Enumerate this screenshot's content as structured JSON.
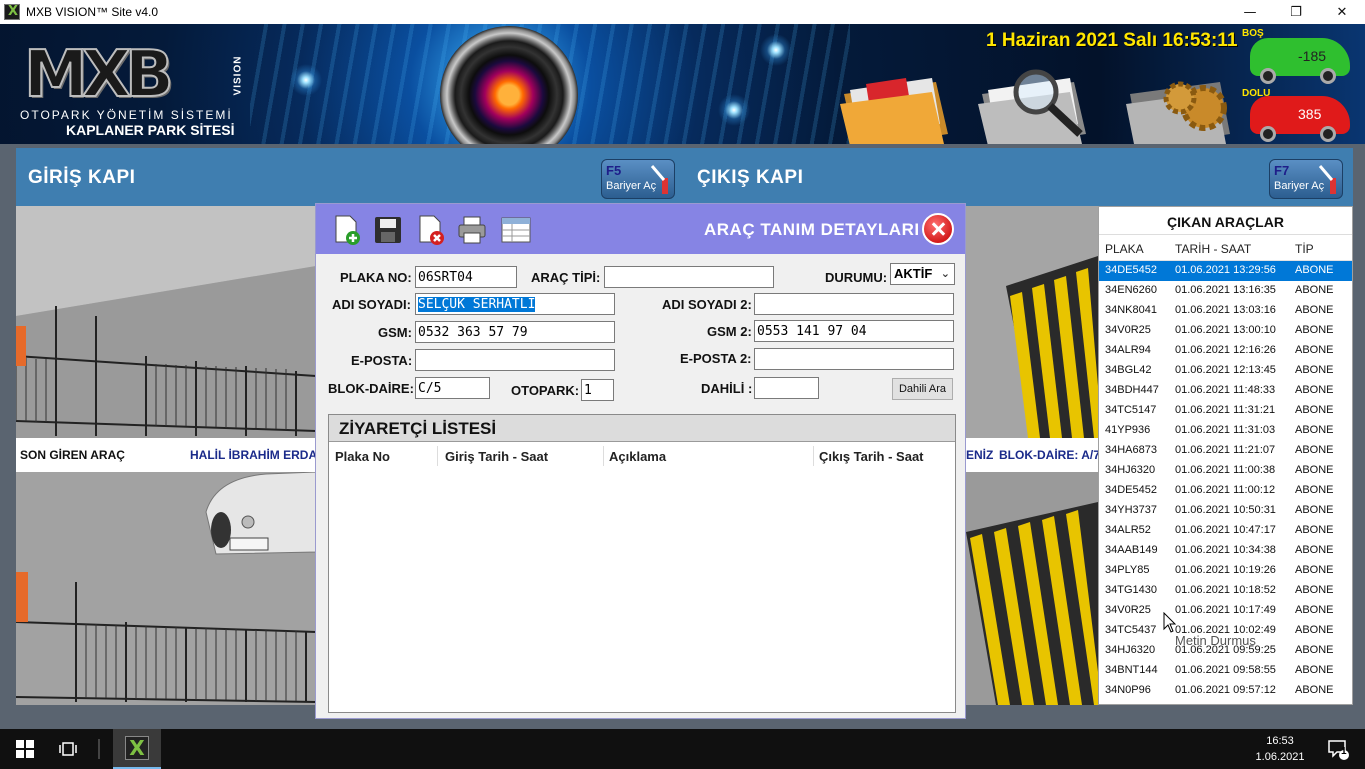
{
  "window": {
    "title": "MXB VISION™ Site v4.0",
    "minimize_icon": "minimize-icon",
    "maximize_icon": "restore-icon",
    "close_icon": "close-icon"
  },
  "banner": {
    "logo_text": "MXB",
    "logo_vision": "VISION",
    "subtitle1": "OTOPARK YÖNETİM SİSTEMİ",
    "subtitle2": "KAPLANER PARK SİTESİ",
    "datetime": "1 Haziran 2021 Salı 16:53:11",
    "empty_label": "BOŞ",
    "empty_count": "-185",
    "full_label": "DOLU",
    "full_count": "385"
  },
  "entry": {
    "title": "GİRİŞ KAPI",
    "barrier_key": "F5",
    "barrier_label": "Bariyer Aç"
  },
  "exit": {
    "title": "ÇIKIŞ KAPI",
    "barrier_key": "F7",
    "barrier_label": "Bariyer Aç"
  },
  "info_strip": {
    "last_entry_label": "SON GİREN ARAÇ",
    "last_entry_name": "HALİL İBRAHİM ERDAL",
    "right_name_fragment": "ENİZ",
    "right_block": "BLOK-DAİRE: A/7"
  },
  "dialog": {
    "title": "ARAÇ TANIM DETAYLARI",
    "toolbar": [
      "new-record-icon",
      "save-icon",
      "delete-icon",
      "print-icon",
      "list-icon"
    ],
    "fields": {
      "plaka_label": "PLAKA NO:",
      "plaka_value": "06SRT04",
      "arac_tipi_label": "ARAÇ TİPİ:",
      "arac_tipi_value": "",
      "durum_label": "DURUMU:",
      "durum_value": "AKTİF",
      "adi_label": "ADI SOYADI:",
      "adi_value": "SELÇUK SERHATLI",
      "adi2_label": "ADI SOYADI 2:",
      "adi2_value": "",
      "gsm_label": "GSM:",
      "gsm_value": "0532 363 57 79",
      "gsm2_label": "GSM 2:",
      "gsm2_value": "0553 141 97 04",
      "eposta_label": "E-POSTA:",
      "eposta_value": "",
      "eposta2_label": "E-POSTA 2:",
      "eposta2_value": "",
      "blok_label": "BLOK-DAİRE:",
      "blok_value": "C/5",
      "otopark_label": "OTOPARK:",
      "otopark_value": "1",
      "dahili_label": "DAHİLİ :",
      "dahili_value": "",
      "dahili_button": "Dahili Ara"
    },
    "visitors": {
      "title": "ZİYARETÇİ LİSTESİ",
      "columns": [
        "Plaka No",
        "Giriş Tarih - Saat",
        "Açıklama",
        "Çıkış Tarih - Saat"
      ]
    }
  },
  "exits_panel": {
    "title": "ÇIKAN ARAÇLAR",
    "columns": [
      "PLAKA",
      "TARİH - SAAT",
      "TİP"
    ],
    "rows": [
      [
        "34DE5452",
        "01.06.2021 13:29:56",
        "ABONE"
      ],
      [
        "34EN6260",
        "01.06.2021 13:16:35",
        "ABONE"
      ],
      [
        "34NK8041",
        "01.06.2021 13:03:16",
        "ABONE"
      ],
      [
        "34V0R25",
        "01.06.2021 13:00:10",
        "ABONE"
      ],
      [
        "34ALR94",
        "01.06.2021 12:16:26",
        "ABONE"
      ],
      [
        "34BGL42",
        "01.06.2021 12:13:45",
        "ABONE"
      ],
      [
        "34BDH447",
        "01.06.2021 11:48:33",
        "ABONE"
      ],
      [
        "34TC5147",
        "01.06.2021 11:31:21",
        "ABONE"
      ],
      [
        "41YP936",
        "01.06.2021 11:31:03",
        "ABONE"
      ],
      [
        "34HA6873",
        "01.06.2021 11:21:07",
        "ABONE"
      ],
      [
        "34HJ6320",
        "01.06.2021 11:00:38",
        "ABONE"
      ],
      [
        "34DE5452",
        "01.06.2021 11:00:12",
        "ABONE"
      ],
      [
        "34YH3737",
        "01.06.2021 10:50:31",
        "ABONE"
      ],
      [
        "34ALR52",
        "01.06.2021 10:47:17",
        "ABONE"
      ],
      [
        "34AAB149",
        "01.06.2021 10:34:38",
        "ABONE"
      ],
      [
        "34PLY85",
        "01.06.2021 10:19:26",
        "ABONE"
      ],
      [
        "34TG1430",
        "01.06.2021 10:18:52",
        "ABONE"
      ],
      [
        "34V0R25",
        "01.06.2021 10:17:49",
        "ABONE"
      ],
      [
        "34TC5437",
        "01.06.2021 10:02:49",
        "ABONE"
      ],
      [
        "34HJ6320",
        "01.06.2021 09:59:25",
        "ABONE"
      ],
      [
        "34BNT144",
        "01.06.2021 09:58:55",
        "ABONE"
      ],
      [
        "34N0P96",
        "01.06.2021 09:57:12",
        "ABONE"
      ]
    ]
  },
  "overlay": {
    "user_name": "Metin Durmus"
  },
  "taskbar": {
    "time": "16:53",
    "date": "1.06.2021",
    "start_icon": "windows-start-icon",
    "taskview_icon": "task-view-icon",
    "app_icon": "mxb-app-icon",
    "notification_icon": "notification-icon",
    "notification_count": "1"
  },
  "colors": {
    "accent": "#0078d7",
    "dialog_header": "#8684e4",
    "gate_bar": "#3f7eb0",
    "datetime": "#ffe600",
    "empty_car": "#2fbf2f",
    "full_car": "#e01a1a"
  }
}
